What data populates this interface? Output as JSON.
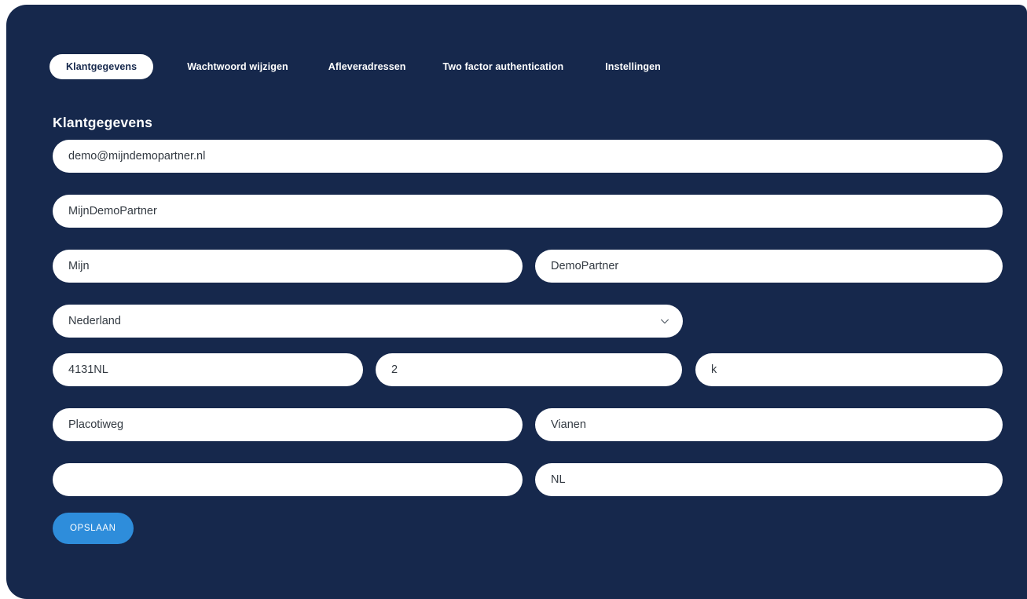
{
  "panel": {
    "background_color": "#16284c",
    "accent_color": "#2e8ddb"
  },
  "tabs": [
    {
      "label": "Klantgegevens",
      "active": true
    },
    {
      "label": "Wachtwoord wijzigen",
      "active": false
    },
    {
      "label": "Afleveradressen",
      "active": false
    },
    {
      "label": "Two factor authentication",
      "active": false
    },
    {
      "label": "Instellingen",
      "active": false
    }
  ],
  "section": {
    "title": "Klantgegevens"
  },
  "form": {
    "email": {
      "value": "demo@mijndemopartner.nl",
      "placeholder": ""
    },
    "company": {
      "value": "MijnDemoPartner",
      "placeholder": ""
    },
    "first_name": {
      "value": "Mijn",
      "placeholder": ""
    },
    "last_name": {
      "value": "DemoPartner",
      "placeholder": ""
    },
    "country": {
      "value": "Nederland",
      "icon": "chevron-down-icon"
    },
    "postal_code": {
      "value": "4131NL",
      "placeholder": ""
    },
    "house_number": {
      "value": "2",
      "placeholder": ""
    },
    "house_number_suffix": {
      "value": "k",
      "placeholder": ""
    },
    "street": {
      "value": "Placotiweg",
      "placeholder": ""
    },
    "city": {
      "value": "Vianen",
      "placeholder": ""
    },
    "extra_address": {
      "value": "",
      "placeholder": ""
    },
    "country_code": {
      "value": "NL",
      "placeholder": ""
    }
  },
  "actions": {
    "save_label": "OPSLAAN"
  }
}
